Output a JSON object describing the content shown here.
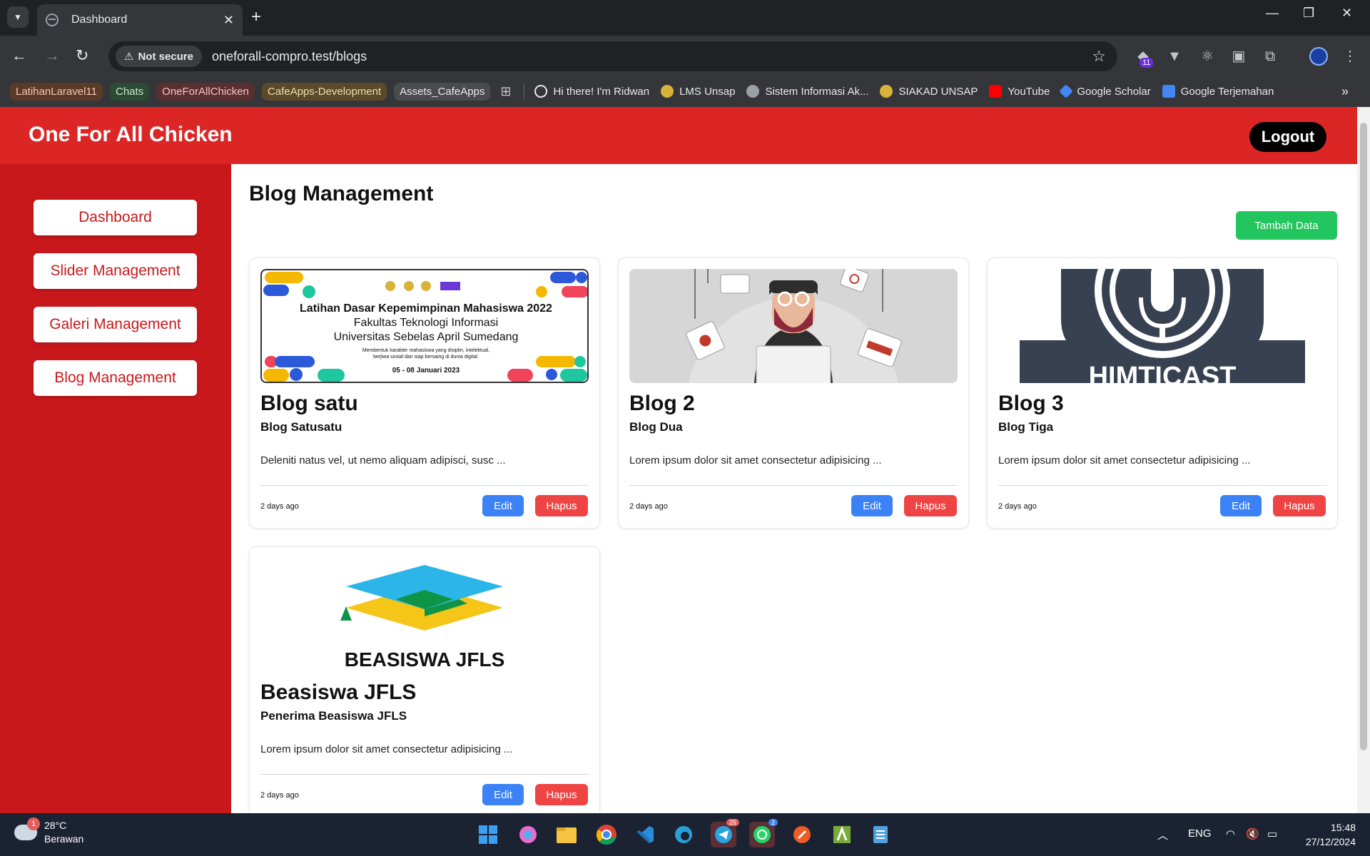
{
  "browser": {
    "tab_title": "Dashboard",
    "new_tab": "+",
    "security_label": "Not secure",
    "url": "oneforall-compro.test/blogs",
    "extension_badge": "11",
    "bookmark_groups": [
      "LatihanLaravel11",
      "Chats",
      "OneForAllChicken",
      "CafeApps-Development",
      "Assets_CafeApps"
    ],
    "bookmarks": [
      "Hi there! I'm Ridwan",
      "LMS Unsap",
      "Sistem Informasi Ak...",
      "SIAKAD UNSAP",
      "YouTube",
      "Google Scholar",
      "Google Terjemahan"
    ]
  },
  "header": {
    "brand": "One For All Chicken",
    "logout_label": "Logout"
  },
  "sidebar": {
    "items": [
      {
        "label": "Dashboard"
      },
      {
        "label": "Slider Management"
      },
      {
        "label": "Galeri Management"
      },
      {
        "label": "Blog Management"
      }
    ]
  },
  "main": {
    "title": "Blog Management",
    "add_label": "Tambah Data",
    "edit_label": "Edit",
    "delete_label": "Hapus",
    "cards": [
      {
        "title": "Blog satu",
        "subtitle": "Blog Satusatu",
        "excerpt": "Deleniti natus vel, ut nemo aliquam adipisci, susc ...",
        "time": "2 days ago",
        "image": {
          "heading1": "Latihan Dasar Kepemimpinan Mahasiswa 2022",
          "heading2": "Fakultas Teknologi Informasi",
          "heading3": "Universitas Sebelas April Sumedang",
          "tagline1": "Membentuk karakter mahasiswa yang disiplin, intelektual,",
          "tagline2": "berjiwa sosial dan siap bersaing di dunia digital.",
          "dates": "05 - 08 Januari 2023"
        }
      },
      {
        "title": "Blog 2",
        "subtitle": "Blog Dua",
        "excerpt": "Lorem ipsum dolor sit amet consectetur adipisicing ...",
        "time": "2 days ago"
      },
      {
        "title": "Blog 3",
        "subtitle": "Blog Tiga",
        "excerpt": "Lorem ipsum dolor sit amet consectetur adipisicing ...",
        "time": "2 days ago",
        "image": {
          "logo_text": "HIMTICAST"
        }
      },
      {
        "title": "Beasiswa JFLS",
        "subtitle": "Penerima Beasiswa JFLS",
        "excerpt": "Lorem ipsum dolor sit amet consectetur adipisicing ...",
        "time": "2 days ago",
        "image": {
          "logo_text": "BEASISWA JFLS"
        }
      }
    ]
  },
  "taskbar": {
    "weather_temp": "28°C",
    "weather_desc": "Berawan",
    "weather_badge": "1",
    "telegram_badge": "25",
    "whatsapp_badge": "2",
    "language": "ENG",
    "time": "15:48",
    "date": "27/12/2024"
  },
  "colors": {
    "header_red": "#dc2626",
    "sidebar_red": "#c9181c",
    "add_green": "#22c55e",
    "edit_blue": "#3b82f6",
    "delete_red": "#ef4444"
  }
}
